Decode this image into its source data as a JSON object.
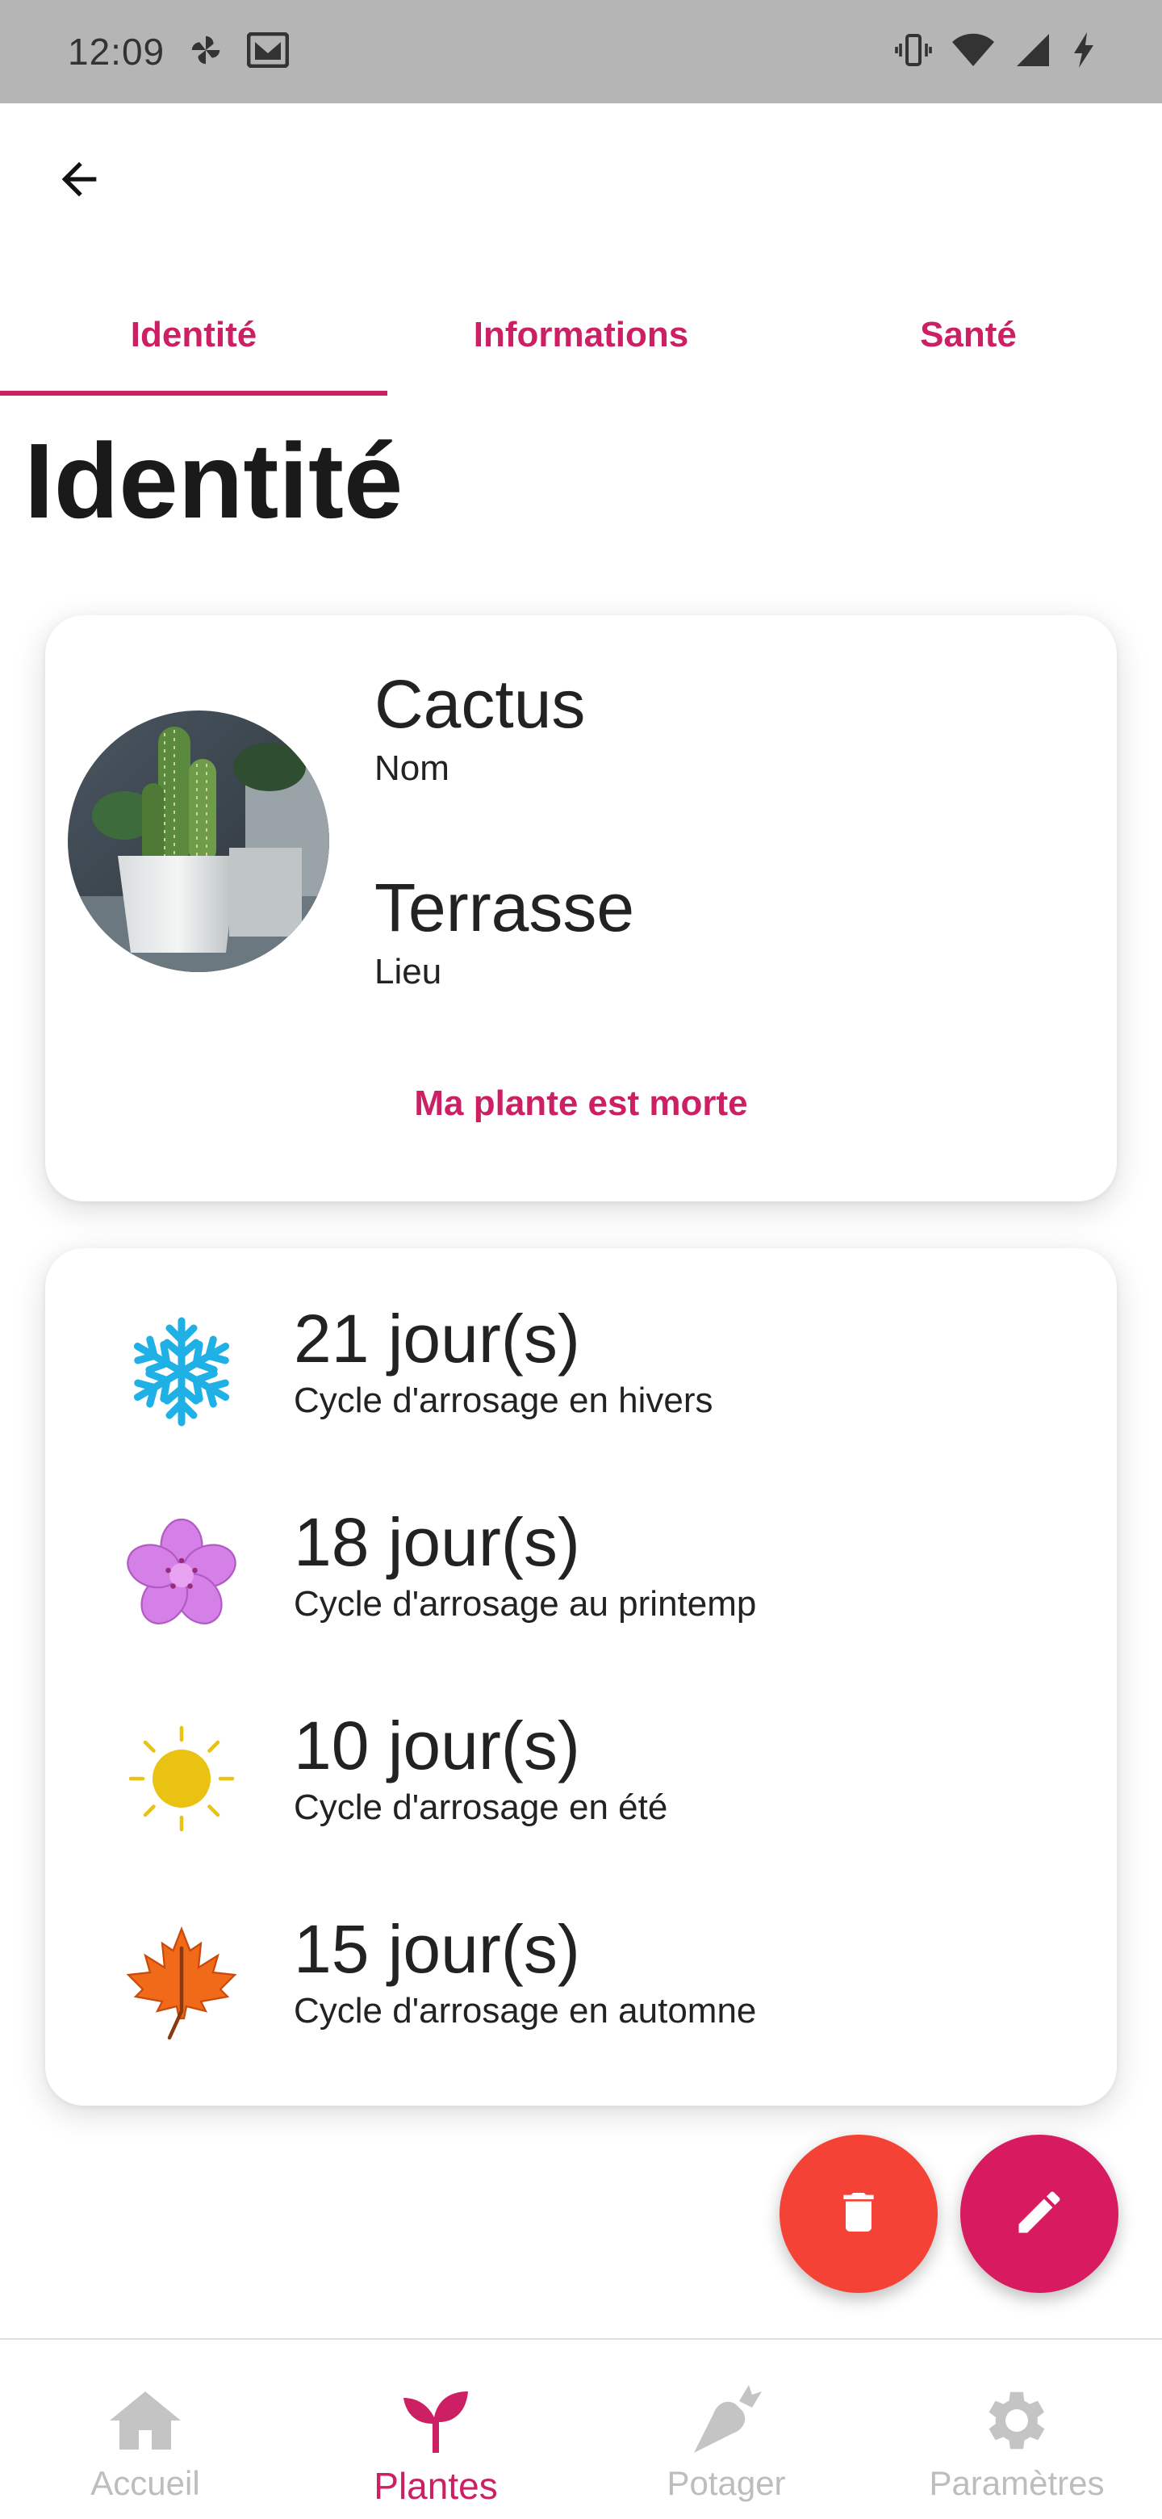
{
  "status_bar": {
    "time": "12:09"
  },
  "tabs": [
    {
      "label": "Identité",
      "active": true
    },
    {
      "label": "Informations",
      "active": false
    },
    {
      "label": "Santé",
      "active": false
    }
  ],
  "page_title": "Identité",
  "identity": {
    "name_value": "Cactus",
    "name_label": "Nom",
    "place_value": "Terrasse",
    "place_label": "Lieu",
    "dead_button": "Ma plante est morte"
  },
  "cycles": [
    {
      "icon": "snowflake-icon",
      "value": "21 jour(s)",
      "label": "Cycle d'arrosage en hivers"
    },
    {
      "icon": "flower-icon",
      "value": "18 jour(s)",
      "label": "Cycle d'arrosage au printemp"
    },
    {
      "icon": "sun-icon",
      "value": "10 jour(s)",
      "label": "Cycle d'arrosage en été"
    },
    {
      "icon": "maple-leaf-icon",
      "value": "15 jour(s)",
      "label": "Cycle d'arrosage en automne"
    }
  ],
  "bottom_nav": [
    {
      "label": "Accueil",
      "icon": "home-icon",
      "active": false
    },
    {
      "label": "Plantes",
      "icon": "sprout-icon",
      "active": true
    },
    {
      "label": "Potager",
      "icon": "carrot-icon",
      "active": false
    },
    {
      "label": "Paramètres",
      "icon": "gear-icon",
      "active": false
    }
  ],
  "colors": {
    "accent": "#cc1f64",
    "delete_fab": "#f44336",
    "edit_fab": "#d81b60",
    "status_bar": "#b5b5b5"
  }
}
